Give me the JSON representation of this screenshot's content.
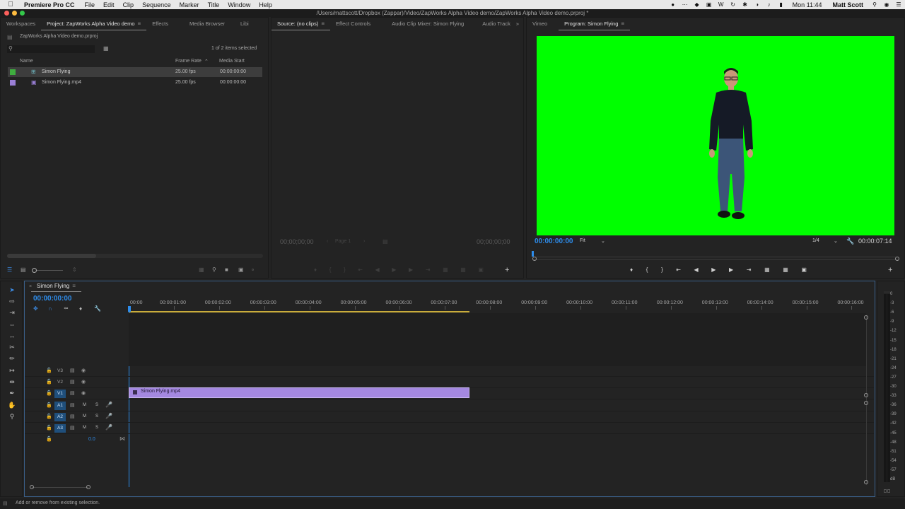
{
  "menubar": {
    "app_name": "Premiere Pro CC",
    "items": [
      "File",
      "Edit",
      "Clip",
      "Sequence",
      "Marker",
      "Title",
      "Window",
      "Help"
    ],
    "clock": "Mon 11:44",
    "user": "Matt Scott"
  },
  "titlebar": {
    "path": "/Users/mattscott/Dropbox (Zappar)/Video/ZapWorks Alpha Video demo/ZapWorks Alpha Video demo.prproj *"
  },
  "project_panel": {
    "tabs": [
      "Workspaces",
      "Project: ZapWorks Alpha Video demo",
      "Effects",
      "Media Browser",
      "Libi"
    ],
    "project_file": "ZapWorks Alpha Video demo.prproj",
    "selection_info": "1 of 2 items selected",
    "columns": [
      "Name",
      "Frame Rate",
      "Media Start"
    ],
    "items": [
      {
        "name": "Simon Flying",
        "frame_rate": "25.00 fps",
        "media_start": "00:00:00:00",
        "color": "#3fae3f"
      },
      {
        "name": "Simon Flying.mp4",
        "frame_rate": "25.00 fps",
        "media_start": "00:00:00:00",
        "color": "#9a7fd6"
      }
    ]
  },
  "source_panel": {
    "tabs": [
      "Source: (no clips)",
      "Effect Controls",
      "Audio Clip Mixer: Simon Flying",
      "Audio Track"
    ],
    "timecode_left": "00;00;00;00",
    "page_label": "Page 1",
    "timecode_right": "00;00;00;00"
  },
  "program_panel": {
    "tabs": [
      "Vimeo",
      "Program: Simon Flying"
    ],
    "screen_color": "#00ff00",
    "timecode": "00:00:00:00",
    "zoom": "Fit",
    "resolution": "1/4",
    "duration": "00:00:07:14"
  },
  "timeline": {
    "sequence_name": "Simon Flying",
    "timecode": "00:00:00:00",
    "ruler": [
      "00:00",
      "00:00:01:00",
      "00:00:02:00",
      "00:00:03:00",
      "00:00:04:00",
      "00:00:05:00",
      "00:00:06:00",
      "00:00:07:00",
      "00:00:08:00",
      "00:00:09:00",
      "00:00:10:00",
      "00:00:11:00",
      "00:00:12:00",
      "00:00:13:00",
      "00:00:14:00",
      "00:00:15:00",
      "00:00:16:00"
    ],
    "tracks": {
      "v3": "V3",
      "v2": "V2",
      "v1": "V1",
      "a1": "A1",
      "a2": "A2",
      "a3": "A3",
      "m": "M",
      "s": "S",
      "master_value": "0.0"
    },
    "clip_name": "Simon Flying.mp4",
    "clip_color": "#a488e0"
  },
  "meter": {
    "labels": [
      "0",
      "-3",
      "-6",
      "-9",
      "-12",
      "-15",
      "-18",
      "-21",
      "-24",
      "-27",
      "-30",
      "-33",
      "-36",
      "-39",
      "-42",
      "-45",
      "-48",
      "-51",
      "-54",
      "-57",
      "dB"
    ]
  },
  "status": {
    "text": "Add or remove from existing selection."
  }
}
